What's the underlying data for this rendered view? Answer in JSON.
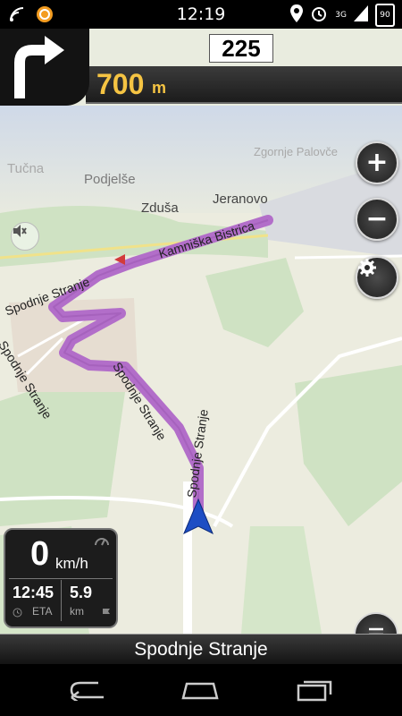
{
  "status_bar": {
    "time": "12:19",
    "network": "3G",
    "battery": "90"
  },
  "maneuver": {
    "icon": "turn-right-icon",
    "street_number": "225",
    "distance_value": "700",
    "distance_unit": "m"
  },
  "map": {
    "labels": {
      "tucna": "Tučna",
      "podjelse": "Podjelše",
      "zdusa": "Zduša",
      "jeranovo": "Jeranovo",
      "kamniska": "Kamniška Bistrica",
      "spodnje_1": "Spodnje Stranje",
      "spodnje_2": "Spodnje Stranje",
      "spodnje_3": "Spodnje Stranje",
      "spodnje_4": "Spodnje Stranje",
      "spodnje_5": "Spodnje Stranje",
      "faint_top": "Zgornje Palovče"
    },
    "controls": {
      "zoom_in": "+",
      "zoom_out": "−"
    }
  },
  "trip_panel": {
    "speed": "0",
    "speed_unit": "km/h",
    "eta": "12:45",
    "eta_label": "ETA",
    "remaining": "5.9",
    "remaining_unit": "km"
  },
  "current_street": "Spodnje Stranje",
  "colors": {
    "route": "#b26ec9",
    "distance": "#f5c443",
    "panel": "#1c1c1c"
  }
}
